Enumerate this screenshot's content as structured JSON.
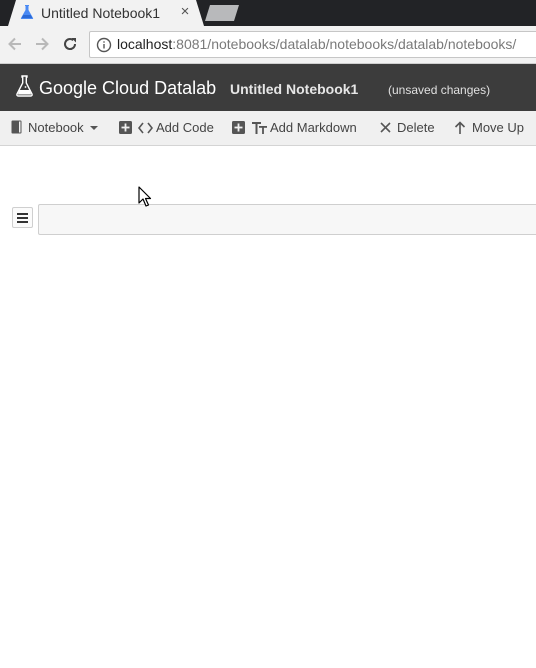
{
  "browser": {
    "tab_title": "Untitled Notebook1",
    "tab_close": "×",
    "url_host": "localhost",
    "url_rest": ":8081/notebooks/datalab/notebooks/datalab/notebooks/"
  },
  "header": {
    "brand": "Google Cloud Datalab",
    "notebook_title": "Untitled Notebook1",
    "status": "(unsaved changes)"
  },
  "toolbar": {
    "notebook_label": "Notebook",
    "add_code_label": "Add Code",
    "add_markdown_label": "Add Markdown",
    "delete_label": "Delete",
    "move_up_label": "Move Up"
  },
  "colors": {
    "header_bg": "#3c3c3c",
    "toolbar_bg": "#f0f0f0",
    "tabstrip_bg": "#222326",
    "flask_blue": "#4a8af4"
  },
  "icons": {
    "tab": "flask-icon",
    "back": "arrow-left-icon",
    "forward": "arrow-right-icon",
    "reload": "reload-icon",
    "info": "info-icon",
    "notebook": "book-icon",
    "add_code": "plus-square-icon",
    "code": "code-brackets-icon",
    "add_markdown": "plus-square-icon",
    "markdown": "text-format-icon",
    "delete": "close-icon",
    "move_up": "arrow-up-icon",
    "cell_menu": "hamburger-icon"
  }
}
